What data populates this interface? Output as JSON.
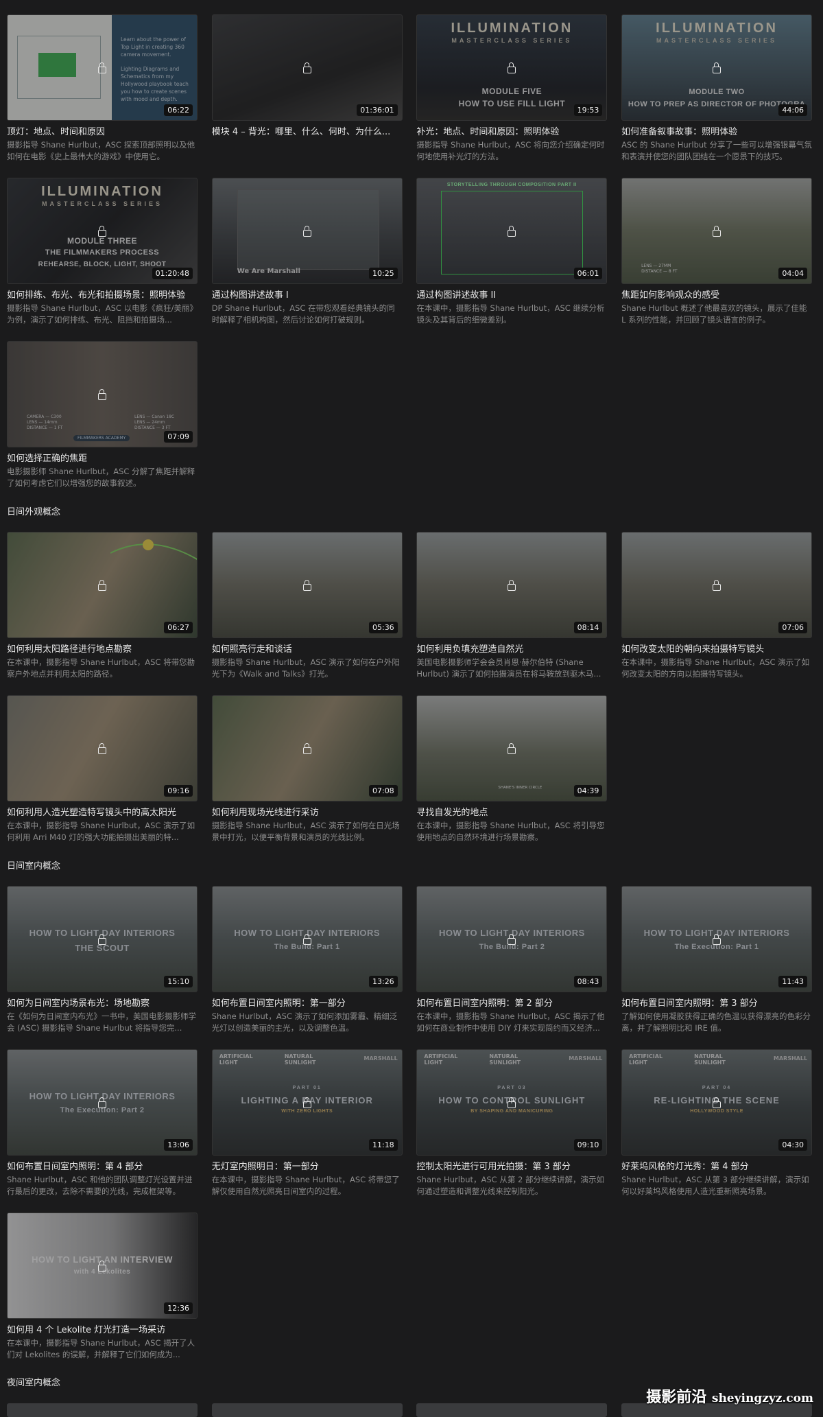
{
  "sections": {
    "daylight_exterior": "日间外观概念",
    "daylight_interior": "日间室内概念",
    "night_interior": "夜间室内概念"
  },
  "watermark": {
    "cn": "摄影前沿",
    "en": "sheyingzyz.com"
  },
  "cards": [
    {
      "title": "顶灯：地点、时间和原因",
      "desc": "摄影指导 Shane Hurlbut，ASC 探索顶部照明以及他如何在电影《史上最伟大的游戏》中使用它。",
      "duration": "06:22",
      "thumb_text": [
        "Learn about the power of",
        "Top Light in creating 360",
        "camera movement.",
        "Lighting Diagrams and",
        "Schematics from my",
        "Hollywood playbook teach",
        "you how to create scenes",
        "with mood and depth."
      ]
    },
    {
      "title": "模块 4 – 背光：哪里、什么、何时、为什么...",
      "desc": "",
      "duration": "01:36:01"
    },
    {
      "title": "补光：地点、时间和原因：照明体验",
      "desc": "摄影指导 Shane Hurlbut，ASC 将向您介绍确定何时何地使用补光灯的方法。",
      "duration": "19:53",
      "thumb_text": [
        "ILLUMINATION",
        "MASTERCLASS SERIES",
        "MODULE FIVE",
        "HOW TO USE FILL LIGHT"
      ]
    },
    {
      "title": "如何准备叙事故事：照明体验",
      "desc": "ASC 的 Shane Hurlbut 分享了一些可以增强银幕气氛和表演并使您的团队团结在一个愿景下的技巧。",
      "duration": "44:06",
      "thumb_text": [
        "ILLUMINATION",
        "MASTERCLASS SERIES",
        "MODULE TWO",
        "HOW TO PREP AS DIRECTOR OF PHOTOGRA"
      ]
    },
    {
      "title": "如何排练、布光、布光和拍摄场景：照明体验",
      "desc": "摄影指导 Shane Hurlbut，ASC 以电影《疯狂/美丽》为例，演示了如何排练、布光、阻挡和拍摄场...",
      "duration": "01:20:48",
      "thumb_text": [
        "ILLUMINATION",
        "MASTERCLASS SERIES",
        "MODULE THREE",
        "THE FILMMAKERS PROCESS",
        "REHEARSE, BLOCK, LIGHT, SHOOT"
      ]
    },
    {
      "title": "通过构图讲述故事 I",
      "desc": "DP Shane Hurlbut，ASC 在带您观看经典镜头的同时解释了相机构图，然后讨论如何打破规则。",
      "duration": "10:25",
      "thumb_text": [
        "We Are Marshall"
      ]
    },
    {
      "title": "通过构图讲述故事 II",
      "desc": "在本课中，摄影指导 Shane Hurlbut，ASC 继续分析镜头及其背后的细微差别。",
      "duration": "06:01",
      "thumb_text": [
        "STORYTELLING THROUGH COMPOSITION PART II"
      ]
    },
    {
      "title": "焦距如何影响观众的感受",
      "desc": "Shane Hurlbut 概述了他最喜欢的镜头，展示了佳能 L 系列的性能，并回顾了镜头语言的例子。",
      "duration": "04:04",
      "thumb_text": [
        "LENS — 27MM",
        "DISTANCE — 8 FT"
      ]
    },
    {
      "title": "如何选择正确的焦距",
      "desc": "电影摄影师 Shane Hurlbut，ASC 分解了焦距并解释了如何考虑它们以增强您的故事叙述。",
      "duration": "07:09",
      "thumb_text": [
        "CAMERA — C300",
        "LENS — 14mm",
        "DISTANCE — 1 FT",
        "LENS — Canon 18C",
        "LENS — 24mm",
        "DISTANCE — 3 FT",
        "FILMMAKERS ACADEMY"
      ]
    },
    {
      "title": "如何利用太阳路径进行地点勘察",
      "desc": "在本课中，摄影指导 Shane Hurlbut，ASC 将带您勘察户外地点并利用太阳的路径。",
      "duration": "06:27"
    },
    {
      "title": "如何照亮行走和谈话",
      "desc": "摄影指导 Shane Hurlbut，ASC 演示了如何在户外阳光下为《Walk and Talks》打光。",
      "duration": "05:36"
    },
    {
      "title": "如何利用负填充塑造自然光",
      "desc": "美国电影摄影师学会会员肖恩·赫尔伯特 (Shane Hurlbut) 演示了如何拍摄演员在将马鞍放到驱木马...",
      "duration": "08:14"
    },
    {
      "title": "如何改变太阳的朝向来拍摄特写镜头",
      "desc": "在本课中，摄影指导 Shane Hurlbut，ASC 演示了如何改变太阳的方向以拍摄特写镜头。",
      "duration": "07:06"
    },
    {
      "title": "如何利用人造光塑造特写镜头中的高太阳光",
      "desc": "在本课中，摄影指导 Shane Hurlbut，ASC 演示了如何利用 Arri M40 灯的强大功能拍摄出美丽的特...",
      "duration": "09:16"
    },
    {
      "title": "如何利用现场光线进行采访",
      "desc": "摄影指导 Shane Hurlbut，ASC 演示了如何在日光场景中打光，以便平衡背景和演员的光线比例。",
      "duration": "07:08"
    },
    {
      "title": "寻找自发光的地点",
      "desc": "在本课中，摄影指导 Shane Hurlbut，ASC 将引导您使用地点的自然环境进行场景勘察。",
      "duration": "04:39",
      "thumb_text": [
        "SHANE'S INNER CIRCLE"
      ]
    },
    {
      "title": "如何为日间室内场景布光：场地勘察",
      "desc": "在《如何为日间室内布光》一书中，美国电影摄影师学会 (ASC) 摄影指导 Shane Hurlbut 将指导您完...",
      "duration": "15:10",
      "thumb_text": [
        "HOW TO LIGHT DAY INTERIORS",
        "THE SCOUT"
      ]
    },
    {
      "title": "如何布置日间室内照明：第一部分",
      "desc": "Shane Hurlbut，ASC 演示了如何添加雾霾、精细泛光灯以创造美丽的主光，以及调整色温。",
      "duration": "13:26",
      "thumb_text": [
        "HOW TO LIGHT DAY INTERIORS",
        "The Build: Part 1"
      ]
    },
    {
      "title": "如何布置日间室内照明：第 2 部分",
      "desc": "在本课中，摄影指导 Shane Hurlbut，ASC 揭示了他如何在商业制作中使用 DIY 灯来实现简约而又经济...",
      "duration": "08:43",
      "thumb_text": [
        "HOW TO LIGHT DAY INTERIORS",
        "The Build: Part 2"
      ]
    },
    {
      "title": "如何布置日间室内照明：第 3 部分",
      "desc": "了解如何使用凝胶获得正确的色温以获得漂亮的色彩分离，并了解照明比和 IRE 值。",
      "duration": "11:43",
      "thumb_text": [
        "HOW TO LIGHT DAY INTERIORS",
        "The Execution: Part 1"
      ]
    },
    {
      "title": "如何布置日间室内照明：第 4 部分",
      "desc": "Shane Hurlbut，ASC 和他的团队调整灯光设置并进行最后的更改，去除不需要的光线，完成框架等。",
      "duration": "13:06",
      "thumb_text": [
        "HOW TO LIGHT DAY INTERIORS",
        "The Execution: Part 2"
      ]
    },
    {
      "title": "无灯室内照明日：第一部分",
      "desc": "在本课中，摄影指导 Shane Hurlbut，ASC 将带您了解仅使用自然光照亮日间室内的过程。",
      "duration": "11:18",
      "thumb_text": [
        "ARTIFICIAL LIGHT",
        "NATURAL SUNLIGHT",
        "PART 01",
        "LIGHTING A DAY INTERIOR",
        "WITH ZERO LIGHTS",
        "MARSHALL"
      ]
    },
    {
      "title": "控制太阳光进行可用光拍摄：第 3 部分",
      "desc": "Shane Hurlbut，ASC 从第 2 部分继续讲解，演示如何通过塑造和调整光线来控制阳光。",
      "duration": "09:10",
      "thumb_text": [
        "ARTIFICIAL LIGHT",
        "NATURAL SUNLIGHT",
        "PART 03",
        "HOW TO CONTROL SUNLIGHT",
        "BY SHAPING AND MANICURING",
        "MARSHALL"
      ]
    },
    {
      "title": "好莱坞风格的灯光秀：第 4 部分",
      "desc": "Shane Hurlbut，ASC 从第 3 部分继续讲解，演示如何以好莱坞风格使用人造光重新照亮场景。",
      "duration": "04:30",
      "thumb_text": [
        "ARTIFICIAL LIGHT",
        "NATURAL SUNLIGHT",
        "PART 04",
        "RE-LIGHTING THE SCENE",
        "HOLLYWOOD STYLE",
        "MARSHALL"
      ]
    },
    {
      "title": "如何用 4 个 Lekolite 灯光打造一场采访",
      "desc": "在本课中，摄影指导 Shane Hurlbut，ASC 揭开了人们对 Lekolites 的误解，并解释了它们如何成为...",
      "duration": "12:36",
      "thumb_text": [
        "HOW TO LIGHT AN INTERVIEW",
        "with 4 Lekolites"
      ]
    }
  ]
}
